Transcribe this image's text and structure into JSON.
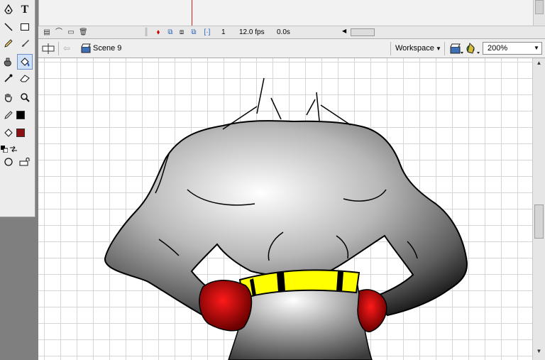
{
  "tools_panel": {
    "text_tool_glyph": "T",
    "stroke_color": "#000000",
    "fill_color": "#8b1010"
  },
  "timeline": {
    "frame_number": "1",
    "frame_rate": "12.0 fps",
    "elapsed_time": "0.0s"
  },
  "edit_bar": {
    "scene_name": "Scene 9",
    "workspace_label": "Workspace",
    "zoom_value": "200%"
  },
  "colors": {
    "accent_red": "#cc0000",
    "belt_yellow": "#ffff00",
    "body_gray": "#9a9a9a"
  }
}
